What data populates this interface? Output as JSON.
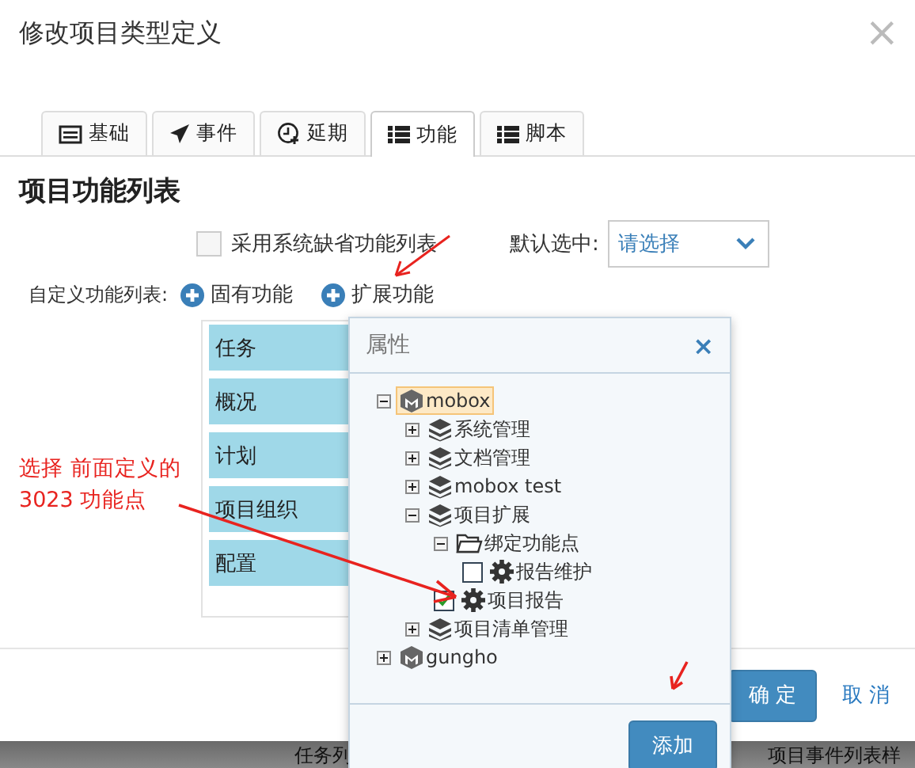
{
  "dialog": {
    "title": "修改项目类型定义",
    "close": "×"
  },
  "tabs": [
    {
      "label": "基础",
      "kind": "form",
      "selected": false
    },
    {
      "label": "事件",
      "kind": "send",
      "selected": false
    },
    {
      "label": "延期",
      "kind": "schedule",
      "selected": false
    },
    {
      "label": "功能",
      "kind": "list",
      "selected": true
    },
    {
      "label": "脚本",
      "kind": "list",
      "selected": false
    }
  ],
  "section_title": "项目功能列表",
  "use_default": {
    "label": "采用系统缺省功能列表",
    "checked": false
  },
  "default_select": {
    "label": "默认选中:",
    "placeholder": "请选择"
  },
  "custom_list": {
    "label": "自定义功能列表:",
    "actions": [
      "固有功能",
      "扩展功能"
    ],
    "items": [
      "任务",
      "概况",
      "计划",
      "项目组织",
      "配置"
    ]
  },
  "popup": {
    "title": "属性",
    "close": "×",
    "button": "添加",
    "tree": [
      {
        "kind": "app",
        "label": "mobox",
        "expanded": true,
        "selected": true,
        "children": [
          {
            "kind": "module",
            "label": "系统管理",
            "expanded": false,
            "selected": false
          },
          {
            "kind": "module",
            "label": "文档管理",
            "expanded": false,
            "selected": false
          },
          {
            "kind": "module",
            "label": "mobox test",
            "expanded": false,
            "selected": false
          },
          {
            "kind": "module",
            "label": "项目扩展",
            "expanded": true,
            "selected": false,
            "children": [
              {
                "kind": "folder",
                "label": "绑定功能点",
                "expanded": true,
                "selected": false,
                "children": [
                  {
                    "kind": "function",
                    "label": "报告维护",
                    "checked": false,
                    "selected": false
                  }
                ]
              },
              {
                "kind": "function",
                "label": "项目报告",
                "checked": true,
                "selected": false
              }
            ]
          },
          {
            "kind": "module",
            "label": "项目清单管理",
            "expanded": false,
            "selected": false
          }
        ]
      },
      {
        "kind": "app",
        "label": "gungho",
        "expanded": false,
        "selected": false
      }
    ]
  },
  "annotation": {
    "lines": [
      "选择 前面定义的",
      "3023 功能点"
    ]
  },
  "footer": {
    "buttons": [
      {
        "label": "确 定",
        "kind": "primary"
      },
      {
        "label": "取 消",
        "kind": "link"
      }
    ]
  },
  "background_texts": [
    "任务列",
    "项目事件列表样"
  ]
}
